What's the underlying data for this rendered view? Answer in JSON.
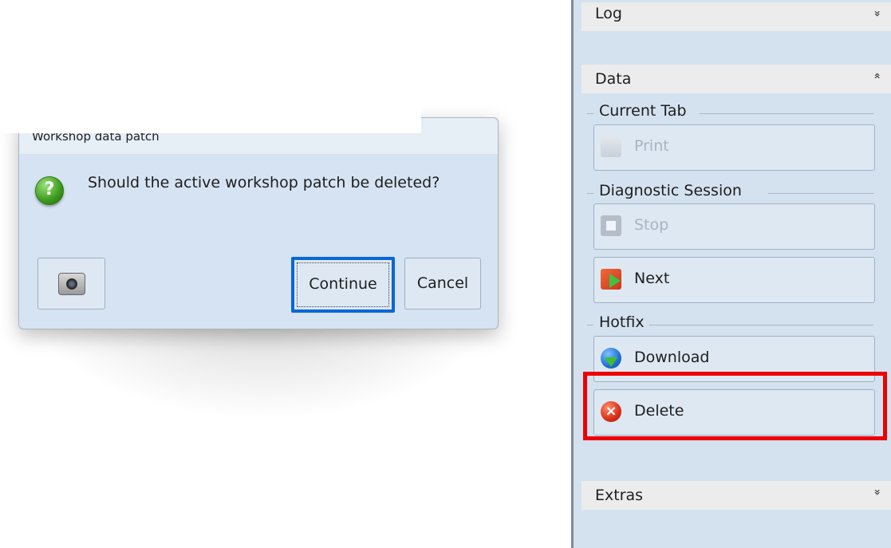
{
  "dialog": {
    "title": "Workshop data patch",
    "message": "Should the active workshop patch be deleted?",
    "buttons": {
      "camera_icon": "camera-icon",
      "continue_label": "Continue",
      "cancel_label": "Cancel"
    },
    "icon": "question-icon"
  },
  "panel": {
    "log": {
      "label": "Log",
      "chevron": "»"
    },
    "data": {
      "label": "Data",
      "chevron": "«",
      "groups": {
        "current_tab": {
          "label": "Current Tab",
          "print_label": "Print"
        },
        "diagnostic_session": {
          "label": "Diagnostic Session",
          "stop_label": "Stop",
          "next_label": "Next"
        },
        "hotfix": {
          "label": "Hotfix",
          "download_label": "Download",
          "delete_label": "Delete"
        }
      }
    },
    "extras": {
      "label": "Extras",
      "chevron": "»"
    }
  },
  "colors": {
    "panel_bg": "#d4e2f0",
    "highlight": "#ee0000",
    "focus": "#0a66d8"
  }
}
